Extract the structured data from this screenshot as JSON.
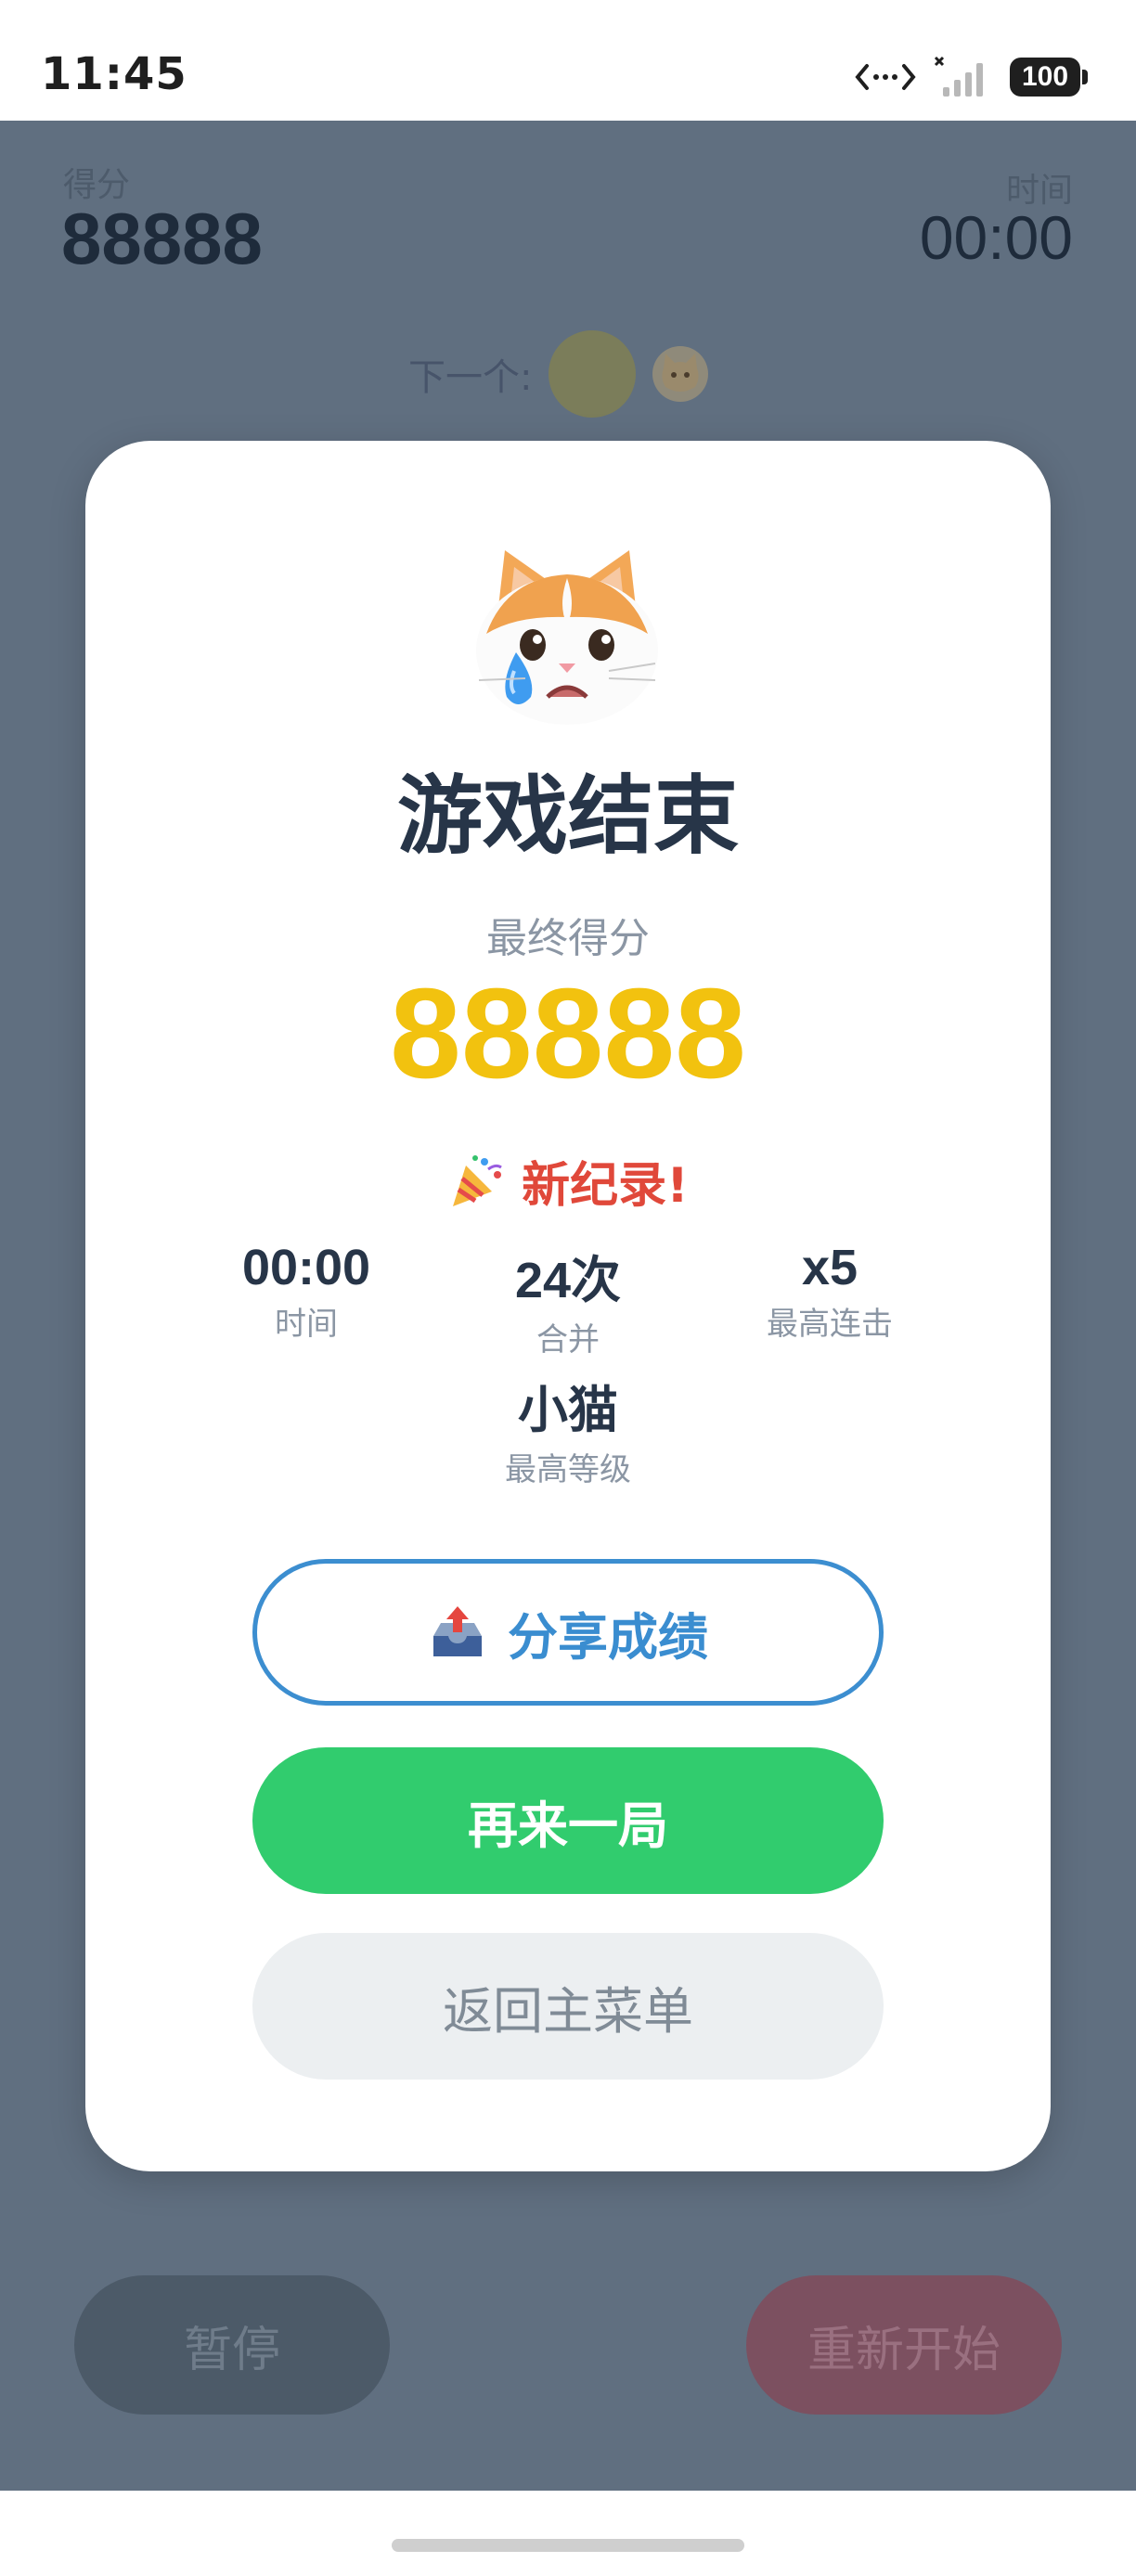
{
  "status_bar": {
    "time": "11:45",
    "battery": "100",
    "icons": [
      "code-icon",
      "signal-icon",
      "battery-icon"
    ]
  },
  "hud": {
    "score_label": "得分",
    "score_value": "88888",
    "time_label": "时间",
    "time_value": "00:00",
    "next_label": "下一个:",
    "next_ball_color": "#7b7d5a"
  },
  "controls": {
    "pause_label": "暂停",
    "restart_label": "重新开始"
  },
  "modal": {
    "title": "游戏结束",
    "final_label": "最终得分",
    "final_score": "88888",
    "record_text": "新纪录!",
    "stats": [
      {
        "value": "00:00",
        "label": "时间"
      },
      {
        "value": "24次",
        "label": "合并"
      },
      {
        "value": "x5",
        "label": "最高连击"
      },
      {
        "value": "小猫",
        "label": "最高等级"
      }
    ],
    "share_label": "分享成绩",
    "again_label": "再来一局",
    "menu_label": "返回主菜单"
  },
  "colors": {
    "overlay": "#606f80",
    "score_gold": "#f2c20f",
    "record_red": "#e0483a",
    "share_blue": "#3a8dd0",
    "again_green": "#31cc6e"
  }
}
